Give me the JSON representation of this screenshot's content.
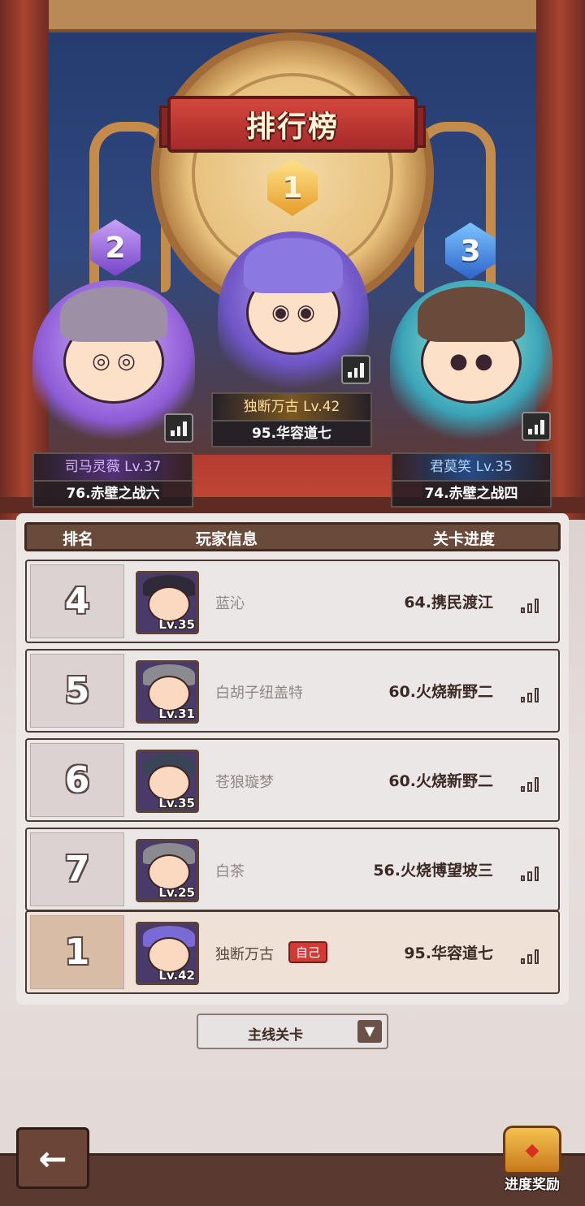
{
  "title": "排行榜",
  "podium": [
    {
      "rank": "1",
      "name": "独断万古 Lv.42",
      "stage": "95.华容道七"
    },
    {
      "rank": "2",
      "name": "司马灵薇 Lv.37",
      "stage": "76.赤壁之战六"
    },
    {
      "rank": "3",
      "name": "君莫笑 Lv.35",
      "stage": "74.赤壁之战四"
    }
  ],
  "table": {
    "headers": {
      "rank": "排名",
      "player": "玩家信息",
      "progress": "关卡进度"
    },
    "rows": [
      {
        "rank": "4",
        "level": "Lv.35",
        "name": "蓝沁",
        "stage": "64.携民渡江"
      },
      {
        "rank": "5",
        "level": "Lv.31",
        "name": "白胡子纽盖特",
        "stage": "60.火烧新野二"
      },
      {
        "rank": "6",
        "level": "Lv.35",
        "name": "苍狼璇梦",
        "stage": "60.火烧新野二"
      },
      {
        "rank": "7",
        "level": "Lv.25",
        "name": "白茶",
        "stage": "56.火烧博望坡三"
      }
    ],
    "self": {
      "rank": "1",
      "level": "Lv.42",
      "name": "独断万古",
      "tag": "自己",
      "stage": "95.华容道七"
    }
  },
  "filter": {
    "selected": "主线关卡"
  },
  "buttons": {
    "back": "←",
    "reward_label": "进度奖励"
  },
  "icons": {
    "stats": "bar-chart-icon",
    "back": "arrow-left-icon",
    "reward": "treasure-chest-icon",
    "caret": "chevron-down-icon"
  },
  "colors": {
    "accent_red": "#d23b35",
    "header_brown": "#6a4a3a",
    "gold": "#e59d2a",
    "silver_purple": "#7645c9",
    "bronze_blue": "#2e63c9"
  }
}
